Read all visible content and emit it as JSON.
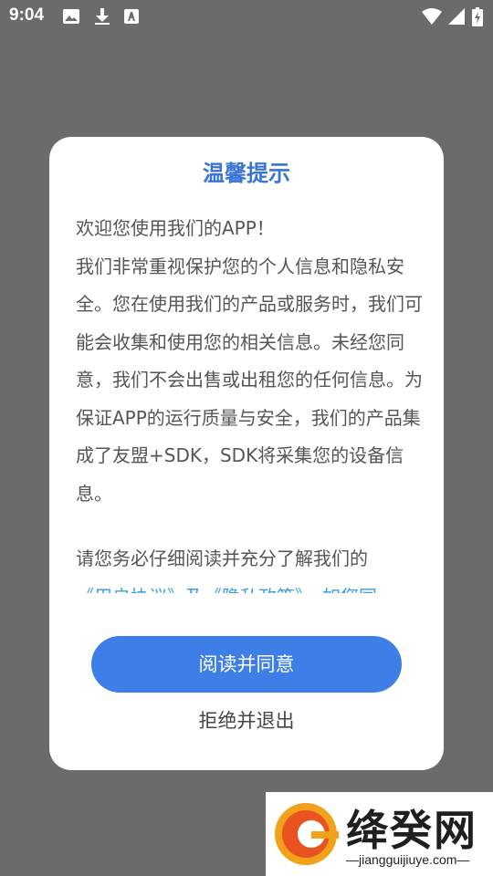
{
  "status_bar": {
    "time": "9:04",
    "icons": [
      "image-icon",
      "download-icon",
      "font-icon",
      "wifi-icon",
      "signal-icon",
      "battery-icon"
    ]
  },
  "dialog": {
    "title": "温馨提示",
    "paragraphs": [
      "欢迎您使用我们的APP！",
      "我们非常重视保护您的个人信息和隐私安全。您在使用我们的产品或服务时，我们可能会收集和使用您的相关信息。未经您同意，我们不会出售或出租您的任何信息。为保证APP的运行质量与安全，我们的产品集成了友盟+SDK，SDK将采集您的设备信息。",
      "请您务必仔细阅读并充分了解我们的"
    ],
    "links_partial": "《用户协议》及《隐私政策》，如您同",
    "agree_button": "阅读并同意",
    "reject_button": "拒绝并退出"
  },
  "watermark": {
    "name": "绛癸网",
    "url": "—jiangguijiuye.com—"
  },
  "colors": {
    "overlay": "#6b6b6b",
    "accent": "#3d7fe6",
    "title": "#3a73d6",
    "link": "#3a9de8"
  }
}
